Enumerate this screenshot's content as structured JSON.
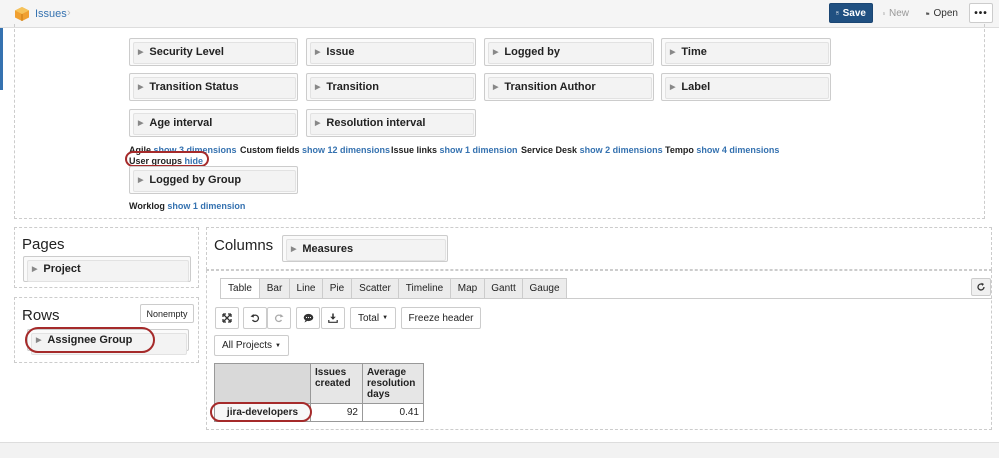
{
  "app": {
    "breadcrumb": "Issues"
  },
  "toolbar": {
    "save_label": "Save",
    "new_label": "New",
    "open_label": "Open",
    "more_label": "•••"
  },
  "dimensions": {
    "row1": [
      "Security Level",
      "Issue",
      "Logged by",
      "Time"
    ],
    "row2": [
      "Transition Status",
      "Transition",
      "Transition Author",
      "Label"
    ],
    "row3": [
      "Age interval",
      "Resolution interval"
    ]
  },
  "groups": {
    "agile": {
      "label": "Agile",
      "link": "show 3 dimensions"
    },
    "custom_fields": {
      "label": "Custom fields",
      "link": "show 12 dimensions"
    },
    "issue_links": {
      "label": "Issue links",
      "link": "show 1 dimension"
    },
    "service_desk": {
      "label": "Service Desk",
      "link": "show 2 dimensions"
    },
    "tempo": {
      "label": "Tempo",
      "link": "show 4 dimensions"
    },
    "user_groups": {
      "label": "User groups",
      "link": "hide"
    },
    "user_groups_dim": "Logged by Group",
    "worklog": {
      "label": "Worklog",
      "link": "show 1 dimension"
    }
  },
  "pages": {
    "title": "Pages",
    "item": "Project"
  },
  "rows": {
    "title": "Rows",
    "nonempty_label": "Nonempty",
    "item": "Assignee Group"
  },
  "columns": {
    "title": "Columns",
    "item": "Measures"
  },
  "tabs": [
    "Table",
    "Bar",
    "Line",
    "Pie",
    "Scatter",
    "Timeline",
    "Map",
    "Gantt",
    "Gauge"
  ],
  "active_tab": "Table",
  "report_toolbar": {
    "total_label": "Total",
    "freeze_label": "Freeze header",
    "projects_label": "All Projects"
  },
  "table": {
    "headers": [
      "Issues created",
      "Average resolution days"
    ],
    "header_lines": [
      [
        "Issues",
        "created"
      ],
      [
        "Average",
        "resolution",
        "days"
      ]
    ],
    "rows": [
      {
        "label": "jira-developers",
        "values": [
          "92",
          "0.41"
        ]
      }
    ]
  },
  "colors": {
    "accent": "#3572b0",
    "save": "#205081",
    "highlight": "#a52a2a"
  }
}
